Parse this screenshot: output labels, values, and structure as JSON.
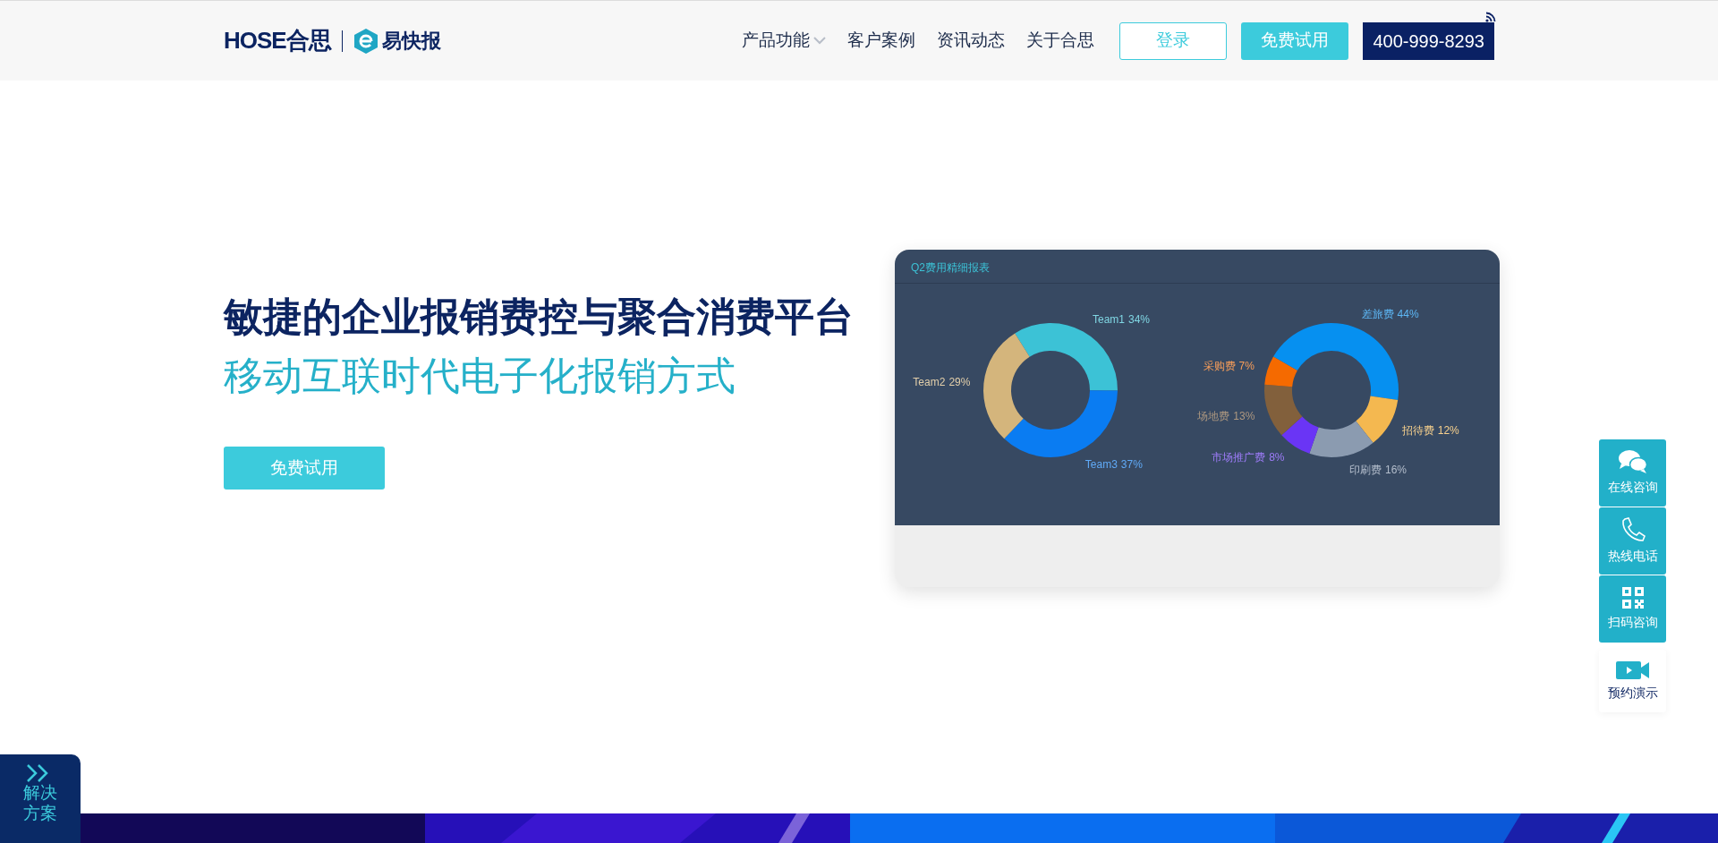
{
  "header": {
    "logo": {
      "brand": "HOSE合思",
      "product": "易快报"
    },
    "nav": [
      {
        "label": "产品功能",
        "has_dropdown": true
      },
      {
        "label": "客户案例",
        "has_dropdown": false
      },
      {
        "label": "资讯动态",
        "has_dropdown": false
      },
      {
        "label": "关于合思",
        "has_dropdown": false
      }
    ],
    "login_button": "登录",
    "trial_button": "免费试用",
    "phone": "400-999-8293"
  },
  "hero": {
    "title": "敏捷的企业报销费控与聚合消费平台",
    "subtitle": "移动互联时代电子化报销方式",
    "cta_button": "免费试用"
  },
  "report": {
    "title": "Q2费用精细报表",
    "charts": [
      {
        "chart_data": {
          "type": "donut",
          "categories": [
            "Team1",
            "Team3",
            "Team2"
          ],
          "values": [
            34,
            37,
            29
          ],
          "value_labels": [
            "34%",
            "37%",
            "29%"
          ],
          "colors": [
            "#3cc2d6",
            "#0a7cf2",
            "#d4b57c"
          ]
        }
      },
      {
        "chart_data": {
          "type": "donut",
          "categories": [
            "差旅费",
            "招待费",
            "印刷费",
            "市场推广费",
            "场地费",
            "采购费"
          ],
          "values": [
            44,
            12,
            16,
            8,
            13,
            7
          ],
          "value_labels": [
            "44%",
            "12%",
            "16%",
            "8%",
            "13%",
            "7%"
          ],
          "colors": [
            "#0690f0",
            "#f4b850",
            "#8b9bb0",
            "#6a35f5",
            "#82603c",
            "#f56a00"
          ]
        }
      }
    ]
  },
  "side_tools": [
    {
      "label": "在线咨询",
      "kind": "chat",
      "highlighted": true
    },
    {
      "label": "热线电话",
      "kind": "phone",
      "highlighted": true
    },
    {
      "label": "扫码咨询",
      "kind": "qr",
      "highlighted": true
    },
    {
      "label": "预约演示",
      "kind": "video",
      "highlighted": false
    }
  ],
  "solutions_tab": {
    "label": "解决方案"
  }
}
